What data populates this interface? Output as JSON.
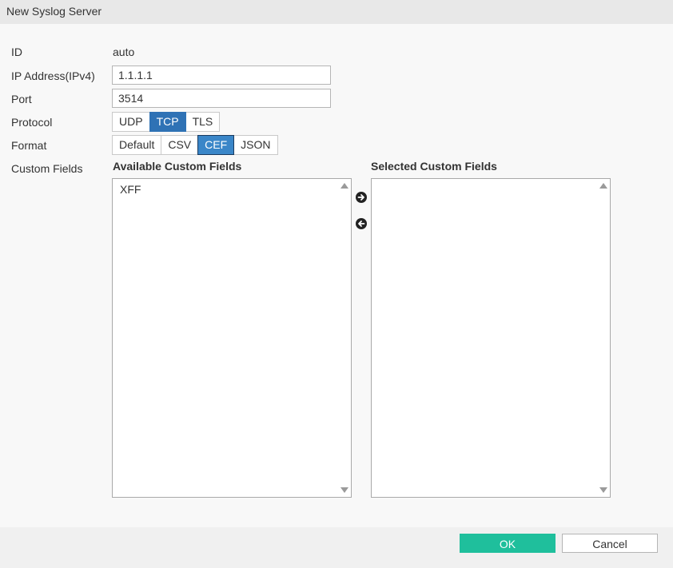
{
  "dialog": {
    "title": "New Syslog Server"
  },
  "form": {
    "id": {
      "label": "ID",
      "value": "auto"
    },
    "ip": {
      "label": "IP Address(IPv4)",
      "value": "1.1.1.1"
    },
    "port": {
      "label": "Port",
      "value": "3514"
    },
    "protocol": {
      "label": "Protocol",
      "options": [
        "UDP",
        "TCP",
        "TLS"
      ],
      "selected": "TCP"
    },
    "format": {
      "label": "Format",
      "options": [
        "Default",
        "CSV",
        "CEF",
        "JSON"
      ],
      "selected": "CEF"
    },
    "custom_fields": {
      "label": "Custom Fields",
      "available_header": "Available Custom Fields",
      "selected_header": "Selected Custom Fields",
      "available_items": [
        "XFF"
      ],
      "selected_items": []
    }
  },
  "footer": {
    "ok_label": "OK",
    "cancel_label": "Cancel"
  },
  "colors": {
    "ok_button": "#1fbf9c",
    "segment_active": "#2f72b5",
    "titlebar": "#e8e8e8"
  },
  "icons": {
    "move_right": "arrow-right-circle-icon",
    "move_left": "arrow-left-circle-icon"
  }
}
